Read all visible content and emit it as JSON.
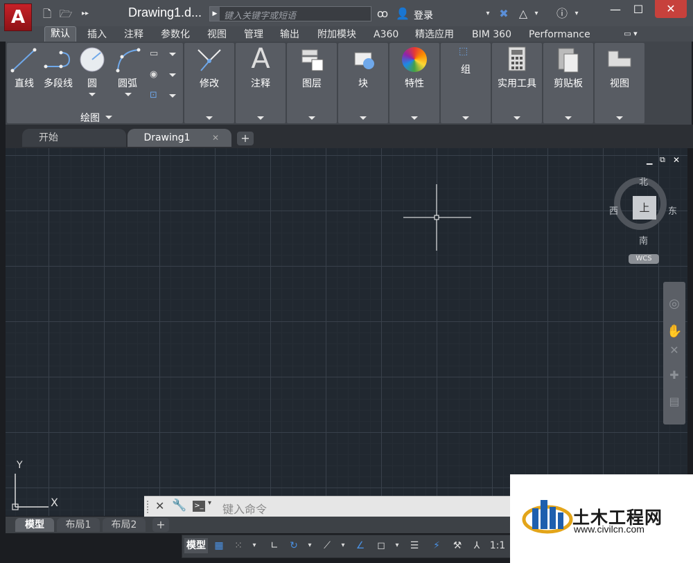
{
  "title_bar": {
    "doc_title": "Drawing1.d...",
    "search_placeholder": "键入关键字或短语",
    "login_label": "登录",
    "app_letter": "A"
  },
  "ribbon_tabs": [
    "默认",
    "插入",
    "注释",
    "参数化",
    "视图",
    "管理",
    "输出",
    "附加模块",
    "A360",
    "精选应用",
    "BIM 360",
    "Performance"
  ],
  "draw_panel": {
    "tools": [
      "直线",
      "多段线",
      "圆",
      "圆弧"
    ],
    "label": "绘图"
  },
  "panels": [
    "修改",
    "注释",
    "图层",
    "块",
    "特性",
    "组",
    "实用工具",
    "剪贴板",
    "视图"
  ],
  "doc_tabs": [
    "开始",
    "Drawing1"
  ],
  "viewcube": {
    "north": "北",
    "south": "南",
    "east": "东",
    "west": "西",
    "face": "上",
    "wcs": "WCS"
  },
  "ucs": {
    "x": "X",
    "y": "Y"
  },
  "command_line": {
    "placeholder": "键入命令"
  },
  "layout_tabs": [
    "模型",
    "布局1",
    "布局2"
  ],
  "status_bar": {
    "model": "模型",
    "scale": "1:1"
  },
  "watermark": {
    "name": "土木工程网",
    "url": "www.civilcn.com"
  },
  "colors": {
    "accent_red": "#c62128",
    "canvas_bg": "#212830",
    "ribbon_panel": "#585c63"
  }
}
